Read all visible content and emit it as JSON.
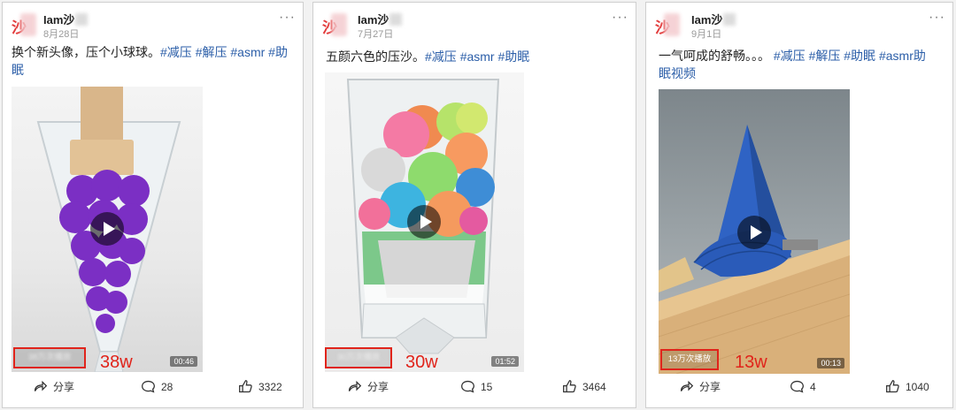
{
  "posts": [
    {
      "username": "Iam沙",
      "date": "8月28日",
      "caption": "换个新头像，压个小球球。",
      "tags": [
        "#减压",
        "#解压",
        "#asmr",
        "#助眠"
      ],
      "views": "38万次播放",
      "duration": "00:46",
      "annotation": "38w",
      "share": "分享",
      "comments": "28",
      "likes": "3322"
    },
    {
      "username": "Iam沙",
      "date": "7月27日",
      "caption": "五颜六色的压沙。",
      "tags": [
        "#减压",
        "#asmr",
        "#助眠"
      ],
      "views": "30万次播放",
      "duration": "01:52",
      "annotation": "30w",
      "share": "分享",
      "comments": "15",
      "likes": "3464"
    },
    {
      "username": "Iam沙",
      "date": "9月1日",
      "caption": "一气呵成的舒畅。。。",
      "tags": [
        "#减压",
        "#解压",
        "#助眠",
        "#asmr助眠视频"
      ],
      "views": "13万次播放",
      "duration": "00:13",
      "annotation": "13w",
      "share": "分享",
      "comments": "4",
      "likes": "1040"
    }
  ],
  "avatar_mark": "沙",
  "more_glyph": "···"
}
